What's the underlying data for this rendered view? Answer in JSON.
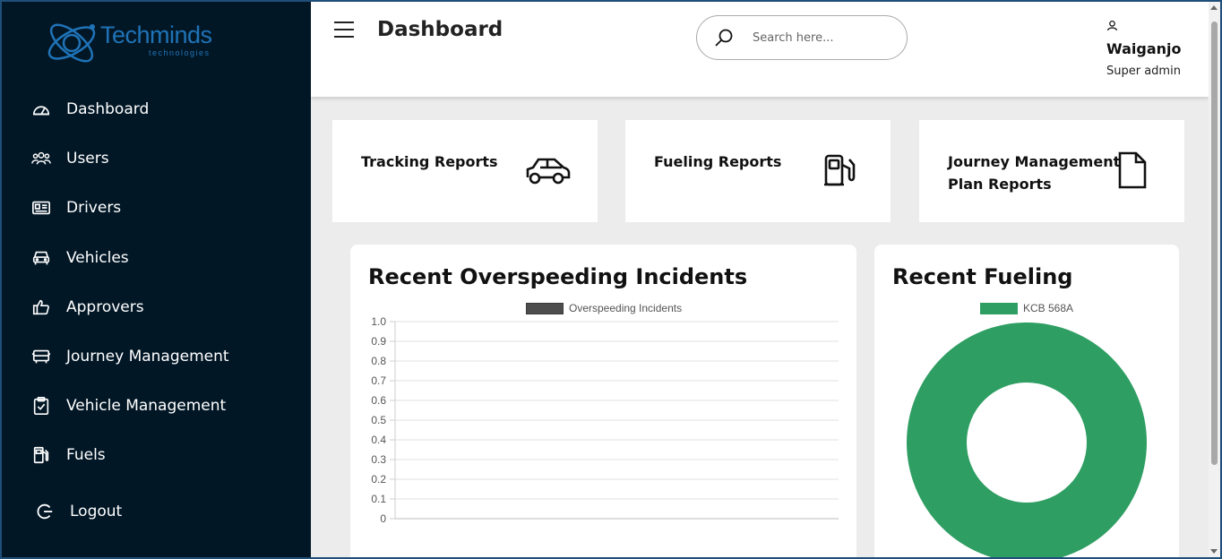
{
  "brand": {
    "name": "Techminds",
    "tagline": "technologies",
    "color": "#1f73b7"
  },
  "sidebar": {
    "background": "#021726",
    "items": [
      {
        "label": "Dashboard",
        "icon": "dashboard-gauge-icon"
      },
      {
        "label": "Users",
        "icon": "users-group-icon"
      },
      {
        "label": "Drivers",
        "icon": "id-card-icon"
      },
      {
        "label": "Vehicles",
        "icon": "car-icon"
      },
      {
        "label": "Approvers",
        "icon": "thumbs-up-icon"
      },
      {
        "label": "Journey Management",
        "icon": "bus-icon"
      },
      {
        "label": "Vehicle Management",
        "icon": "clipboard-check-icon"
      },
      {
        "label": "Fuels",
        "icon": "fuel-pump-icon"
      }
    ],
    "logout_label": "Logout"
  },
  "header": {
    "title": "Dashboard",
    "search_placeholder": "Search here...",
    "user_name": "Waiganjo",
    "user_role": "Super admin"
  },
  "report_cards": [
    {
      "title": "Tracking Reports",
      "icon": "car-icon"
    },
    {
      "title": "Fueling Reports",
      "icon": "fuel-pump-icon"
    },
    {
      "title": "Journey Management Plan Reports",
      "icon": "document-icon"
    }
  ],
  "overspeeding": {
    "title": "Recent Overspeeding Incidents"
  },
  "fueling": {
    "title": "Recent Fueling"
  },
  "chart_data": [
    {
      "type": "bar",
      "series": [
        {
          "name": "Overspeeding Incidents",
          "values": [],
          "color": "#4d4d4d"
        }
      ],
      "categories": [],
      "ylim": [
        0,
        1.0
      ],
      "yticks": [
        "1.0",
        "0.9",
        "0.8",
        "0.7",
        "0.6",
        "0.5",
        "0.4",
        "0.3",
        "0.2",
        "0.1",
        "0"
      ],
      "grid": true,
      "legend": "top-center"
    },
    {
      "type": "pie",
      "variant": "doughnut",
      "labels": [
        "KCB 568A"
      ],
      "values": [
        100
      ],
      "colors": [
        "#2e9e62"
      ],
      "legend": "top-center"
    }
  ]
}
